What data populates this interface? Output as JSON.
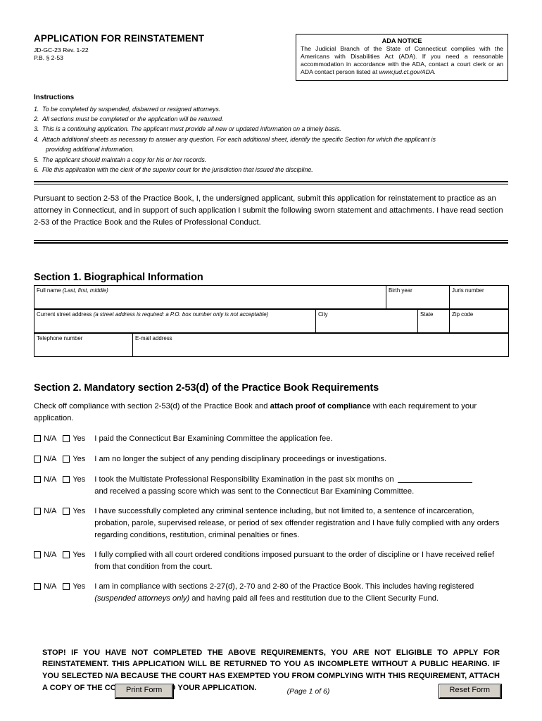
{
  "header": {
    "form_title": "APPLICATION FOR REINSTATEMENT",
    "form_code": "JD-GC-23   Rev. 1-22",
    "practice_book_ref": "P.B. § 2-53",
    "ada": {
      "title": "ADA NOTICE",
      "body_before_link": "The Judicial Branch of the State of Connecticut complies with the Americans with Disabilities Act (ADA). If you need a reasonable accommodation in accordance with the ADA, contact a court clerk or an ADA contact person listed at ",
      "link_text": "www.jud.ct.gov/ADA."
    }
  },
  "instructions": {
    "title": "Instructions",
    "items": [
      {
        "num": "1.",
        "text": "To be completed by suspended, disbarred or resigned attorneys.",
        "cont": ""
      },
      {
        "num": "2.",
        "text": "All sections must be completed or the application will be returned.",
        "cont": ""
      },
      {
        "num": "3.",
        "text": "This is a continuing application. The applicant must provide all new or updated information on a timely basis.",
        "cont": ""
      },
      {
        "num": "4.",
        "text": "Attach additional sheets as necessary to answer any question. For each additional sheet, identify the specific Section for which the applicant is",
        "cont": "providing additional information."
      },
      {
        "num": "5.",
        "text": "The applicant should maintain a copy for his or her records.",
        "cont": ""
      },
      {
        "num": "6.",
        "text": "File this application with the clerk of the superior court for the jurisdiction that issued the discipline.",
        "cont": ""
      }
    ]
  },
  "pursuant_paragraph": "Pursuant to section 2-53 of the Practice Book, I, the undersigned applicant, submit this application for reinstatement to practice as an attorney in Connecticut, and in support of such application I submit the following sworn statement and attachments. I have read section 2-53 of the Practice Book and the Rules of Professional Conduct.",
  "section1": {
    "heading": "Section 1. Biographical Information",
    "fields": {
      "full_name_label": "Full name ",
      "full_name_hint": "(Last, first, middle)",
      "birth_year_label": "Birth year",
      "juris_number_label": "Juris number",
      "street_address_label": "Current street address ",
      "street_address_hint": "(a street address is required: a P.O. box number only is not acceptable)",
      "city_label": "City",
      "state_label": "State",
      "zip_label": "Zip code",
      "telephone_label": "Telephone number",
      "email_label": "E-mail address"
    },
    "values": {
      "full_name": "",
      "birth_year": "",
      "juris_number": "",
      "street_address": "",
      "city": "",
      "state": "",
      "zip": "",
      "telephone": "",
      "email": ""
    }
  },
  "section2": {
    "heading": "Section 2. Mandatory section 2-53(d) of the Practice Book Requirements",
    "intro_part1": "Check off compliance with section 2-53(d) of the Practice Book and ",
    "intro_bold": "attach proof of compliance",
    "intro_part2": " with each requirement to your application.",
    "na_label": "N/A",
    "yes_label": "Yes",
    "items": [
      {
        "text": "I paid the Connecticut Bar Examining Committee the application fee.",
        "na_checked": false,
        "yes_checked": false
      },
      {
        "text": "I am no longer the subject of any pending disciplinary proceedings or investigations.",
        "na_checked": false,
        "yes_checked": false
      },
      {
        "text": "I took the Multistate Professional Responsibility Examination in the past six months on ",
        "has_blank": true,
        "blank_value": "",
        "text_after_blank": "and received a passing score which was sent to the Connecticut Bar Examining Committee.",
        "na_checked": false,
        "yes_checked": false
      },
      {
        "text": "I have successfully completed any criminal sentence including, but not limited to, a sentence of incarceration, probation, parole, supervised release, or period of sex offender registration and I have fully complied with any orders regarding conditions, restitution, criminal penalties or fines.",
        "na_checked": false,
        "yes_checked": false
      },
      {
        "text": "I fully complied with all court ordered conditions imposed pursuant to the order of discipline or I have received relief from that condition from the court.",
        "na_checked": false,
        "yes_checked": false
      },
      {
        "text_pre_italic": "I am in compliance with sections 2-27(d), 2-70 and 2-80 of the Practice Book. This includes having registered ",
        "text_italic": "(suspended attorneys only)",
        "text_post_italic": " and having paid all fees and restitution due to the Client Security Fund.",
        "na_checked": false,
        "yes_checked": false
      }
    ]
  },
  "stop_note": "STOP!  IF YOU HAVE NOT COMPLETED THE ABOVE REQUIREMENTS, YOU ARE NOT ELIGIBLE TO APPLY FOR REINSTATEMENT. THIS APPLICATION WILL BE RETURNED TO YOU AS INCOMPLETE WITHOUT A PUBLIC HEARING. IF YOU SELECTED N/A BECAUSE THE COURT HAS EXEMPTED YOU FROM COMPLYING WITH THIS REQUIREMENT, ATTACH A COPY OF THE COURT ORDER TO YOUR APPLICATION.",
  "footer": {
    "print_button": "Print Form",
    "page_indicator": "(Page 1 of 6)",
    "reset_button": "Reset Form"
  }
}
